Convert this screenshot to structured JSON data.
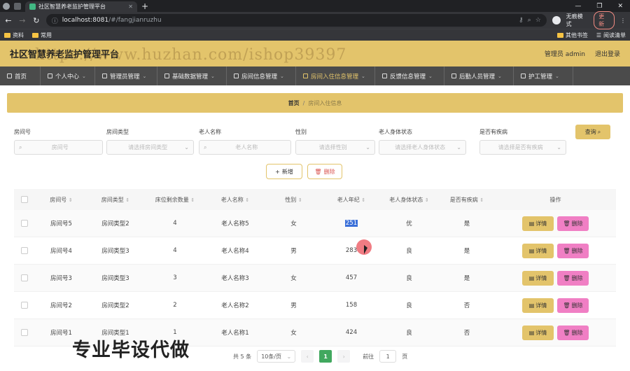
{
  "browser": {
    "tab_title": "社区智慧养老监护管理平台",
    "url_host": "localhost:8081",
    "url_path": "/#/fangjianruzhu",
    "profile_label": "无痕模式",
    "update_label": "更新",
    "bookmarks": [
      "资料",
      "常用"
    ],
    "bookmarks_right": [
      "其他书签",
      "阅读清单"
    ]
  },
  "app": {
    "title": "社区智慧养老监护管理平台",
    "admin_label": "管理员 admin",
    "logout_label": "退出登录"
  },
  "menu": [
    {
      "label": "首页",
      "has_dropdown": false,
      "active": false
    },
    {
      "label": "个人中心",
      "has_dropdown": true,
      "active": false
    },
    {
      "label": "管理员管理",
      "has_dropdown": true,
      "active": false
    },
    {
      "label": "基础数据管理",
      "has_dropdown": true,
      "active": false
    },
    {
      "label": "房间信息管理",
      "has_dropdown": true,
      "active": false
    },
    {
      "label": "房间入住信息管理",
      "has_dropdown": true,
      "active": true
    },
    {
      "label": "反馈信息管理",
      "has_dropdown": true,
      "active": false
    },
    {
      "label": "后勤人员管理",
      "has_dropdown": true,
      "active": false
    },
    {
      "label": "护工管理",
      "has_dropdown": true,
      "active": false
    }
  ],
  "breadcrumb": {
    "home": "首页",
    "separator": "/",
    "current": "房间入住信息"
  },
  "filters": {
    "room_no": {
      "label": "房间号",
      "placeholder": "房间号"
    },
    "room_type": {
      "label": "房间类型",
      "placeholder": "请选择房间类型"
    },
    "elder_name": {
      "label": "老人名称",
      "placeholder": "老人名称"
    },
    "gender": {
      "label": "性别",
      "placeholder": "请选择性别"
    },
    "health": {
      "label": "老人身体状态",
      "placeholder": "请选择老人身体状态"
    },
    "disease": {
      "label": "是否有疾病",
      "placeholder": "请选择是否有疾病"
    },
    "query_label": "查询"
  },
  "actions": {
    "add_label": "新增",
    "delete_label": "删除"
  },
  "table": {
    "headers": [
      "房间号",
      "房间类型",
      "床位剩余数量",
      "老人名称",
      "性别",
      "老人年纪",
      "老人身体状态",
      "是否有疾病",
      "操作"
    ],
    "rows": [
      {
        "room": "房间号5",
        "type": "房间类型2",
        "beds": "4",
        "name": "老人名称5",
        "gender": "女",
        "age": "251",
        "health": "优",
        "disease": "是"
      },
      {
        "room": "房间号4",
        "type": "房间类型3",
        "beds": "4",
        "name": "老人名称4",
        "gender": "男",
        "age": "283",
        "health": "良",
        "disease": "是"
      },
      {
        "room": "房间号3",
        "type": "房间类型3",
        "beds": "3",
        "name": "老人名称3",
        "gender": "女",
        "age": "457",
        "health": "良",
        "disease": "是"
      },
      {
        "room": "房间号2",
        "type": "房间类型2",
        "beds": "2",
        "name": "老人名称2",
        "gender": "男",
        "age": "158",
        "health": "良",
        "disease": "否"
      },
      {
        "room": "房间号1",
        "type": "房间类型1",
        "beds": "1",
        "name": "老人名称1",
        "gender": "女",
        "age": "424",
        "health": "良",
        "disease": "否"
      }
    ],
    "detail_label": "详情",
    "row_delete_label": "删除"
  },
  "pagination": {
    "total_label": "共 5 条",
    "page_size": "10条/页",
    "current_page": "1",
    "jump_prefix": "前往",
    "jump_value": "1",
    "jump_suffix": "页"
  },
  "watermarks": {
    "url": "https://www.huzhan.com/ishop39397",
    "promo": "专业毕设代做"
  },
  "colors": {
    "accent": "#e3c46b",
    "menu_bg": "#4b4b4b",
    "delete_pink": "#f07fc4",
    "page_active": "#41a85f"
  }
}
